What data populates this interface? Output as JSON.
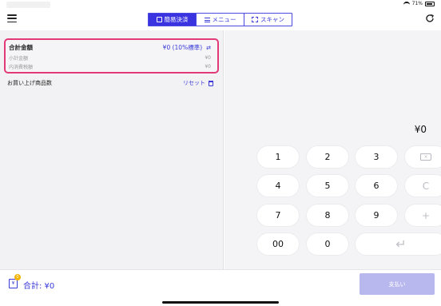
{
  "status_bar": {
    "battery": "71%"
  },
  "header": {
    "tabs": [
      {
        "label": "簡易決済",
        "icon": "calculator-icon",
        "active": true
      },
      {
        "label": "メニュー",
        "icon": "list-icon",
        "active": false
      },
      {
        "label": "スキャン",
        "icon": "scan-icon",
        "active": false
      }
    ]
  },
  "summary": {
    "total_label": "合計金額",
    "total_value": "¥0 (10%標準)",
    "subtotal_label": "小計金額",
    "subtotal_value": "¥0",
    "tax_label": "内消費税額",
    "tax_value": "¥0"
  },
  "items": {
    "title": "お買い上げ商品数",
    "reset_label": "リセット"
  },
  "keypad": {
    "amount": "¥0",
    "keys": [
      "1",
      "2",
      "3",
      "4",
      "5",
      "6",
      "7",
      "8",
      "9",
      "00",
      "0"
    ],
    "clear_label": "C",
    "plus_label": "+",
    "enter_label": "↵"
  },
  "footer": {
    "total_text": "合計: ¥0",
    "badge": "0",
    "pay_label": "支払い"
  },
  "colors": {
    "accent": "#3a34e0",
    "highlight": "#e23a78",
    "pay_disabled": "#b8b8ee"
  }
}
